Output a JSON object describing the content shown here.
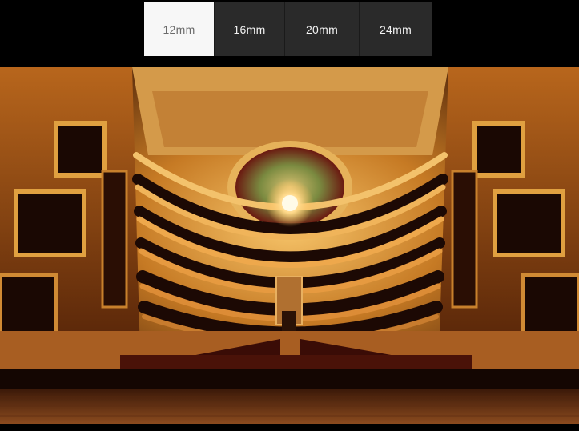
{
  "focal_tabs": {
    "selected": "12mm",
    "items": [
      {
        "label": "12mm",
        "active": true
      },
      {
        "label": "16mm",
        "active": false
      },
      {
        "label": "20mm",
        "active": false
      },
      {
        "label": "24mm",
        "active": false
      }
    ]
  },
  "photo": {
    "subject": "opera-house-interior",
    "icon": "photograph"
  },
  "colors": {
    "tab_active_bg": "#f7f7f7",
    "tab_bg": "#2a2a2a",
    "gold": "#e0a040",
    "deep_red": "#5a1208",
    "stage_wood": "#6b3414"
  }
}
